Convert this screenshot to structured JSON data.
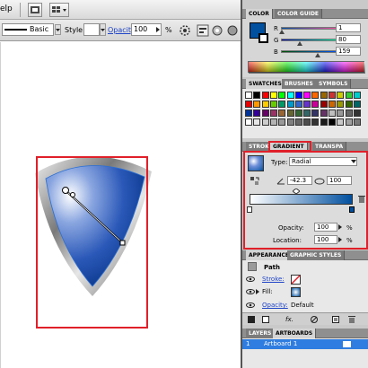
{
  "menubar": {
    "help_label": "elp"
  },
  "control_bar": {
    "stroke_style": "Basic",
    "style_label": "Style:",
    "opacity_label": "Opacity:",
    "opacity_value": "100",
    "percent": "%"
  },
  "color_panel": {
    "tabs": [
      "COLOR",
      "COLOR GUIDE"
    ],
    "channels": [
      {
        "name": "R",
        "value": "1",
        "slider_fraction": 0.004
      },
      {
        "name": "G",
        "value": "80",
        "slider_fraction": 0.31
      },
      {
        "name": "B",
        "value": "159",
        "slider_fraction": 0.62
      }
    ],
    "fill_color": "#01509f"
  },
  "swatches_panel": {
    "tabs": [
      "SWATCHES",
      "BRUSHES",
      "SYMBOLS"
    ]
  },
  "gradient_panel": {
    "tabs": [
      "STROKE",
      "GRADIENT",
      "TRANSPA"
    ],
    "type_label": "Type:",
    "type_value": "Radial",
    "angle_value": "-42.3",
    "aspect_value": "100",
    "opacity_label": "Opacity:",
    "opacity_value": "100",
    "location_label": "Location:",
    "location_value": "100",
    "percent": "%"
  },
  "appearance_panel": {
    "tabs": [
      "APPEARANCE",
      "GRAPHIC STYLES"
    ],
    "item_title": "Path",
    "stroke_label": "Stroke:",
    "fill_label": "Fill:",
    "opacity_label": "Opacity:",
    "opacity_value": "Default"
  },
  "layers_panel": {
    "tabs": [
      "LAYERS",
      "ARTBOARDS"
    ],
    "row_number": "1",
    "row_name": "Artboard 1"
  },
  "colors": {
    "highlight_red": "#e0202a",
    "shield_blue": "#01509f",
    "selection_blue": "#2a6fd6"
  }
}
